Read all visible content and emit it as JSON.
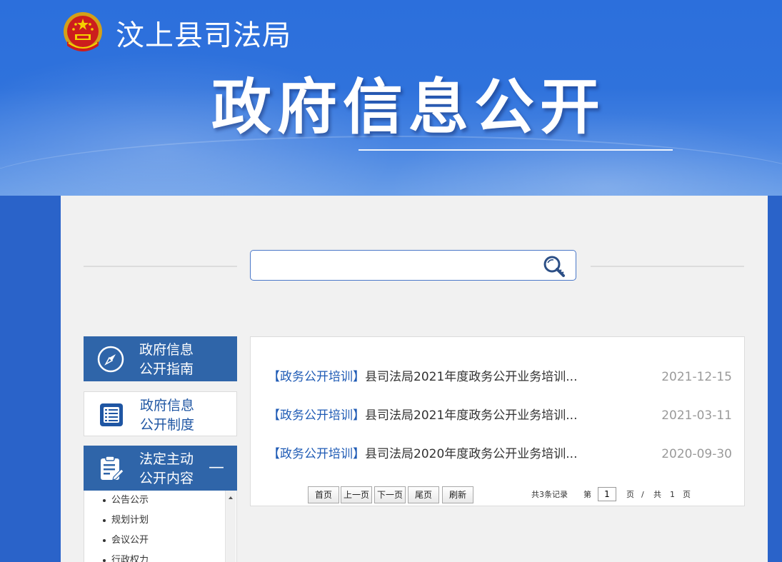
{
  "header": {
    "site_name": "汶上县司法局",
    "banner_title": "政府信息公开"
  },
  "search": {
    "placeholder": "",
    "value": ""
  },
  "nav": {
    "guide": {
      "line1": "政府信息",
      "line2": "公开指南"
    },
    "system": {
      "line1": "政府信息",
      "line2": "公开制度"
    },
    "content": {
      "line1": "法定主动",
      "line2": "公开内容",
      "toggle": "—"
    },
    "sub_items": [
      "公告公示",
      "规划计划",
      "会议公开",
      "行政权力"
    ]
  },
  "list": {
    "items": [
      {
        "category": "【政务公开培训】",
        "title": "县司法局2021年度政务公开业务培训...",
        "date": "2021-12-15"
      },
      {
        "category": "【政务公开培训】",
        "title": "县司法局2021年度政务公开业务培训...",
        "date": "2021-03-11"
      },
      {
        "category": "【政务公开培训】",
        "title": "县司法局2020年度政务公开业务培训...",
        "date": "2020-09-30"
      }
    ]
  },
  "pager": {
    "first": "首页",
    "prev": "上一页",
    "next": "下一页",
    "last": "尾页",
    "refresh": "刷新",
    "total_records": "共3条记录",
    "page_prefix": "第",
    "current_page": "1",
    "page_suffix": "页",
    "slash": "/",
    "total_prefix": "共",
    "total_pages": "1",
    "total_suffix": "页"
  },
  "colors": {
    "banner_blue": "#2c6fdc",
    "nav_blue": "#2f65a9",
    "category_blue": "#1f5bb5",
    "date_gray": "#9a9a9a"
  }
}
